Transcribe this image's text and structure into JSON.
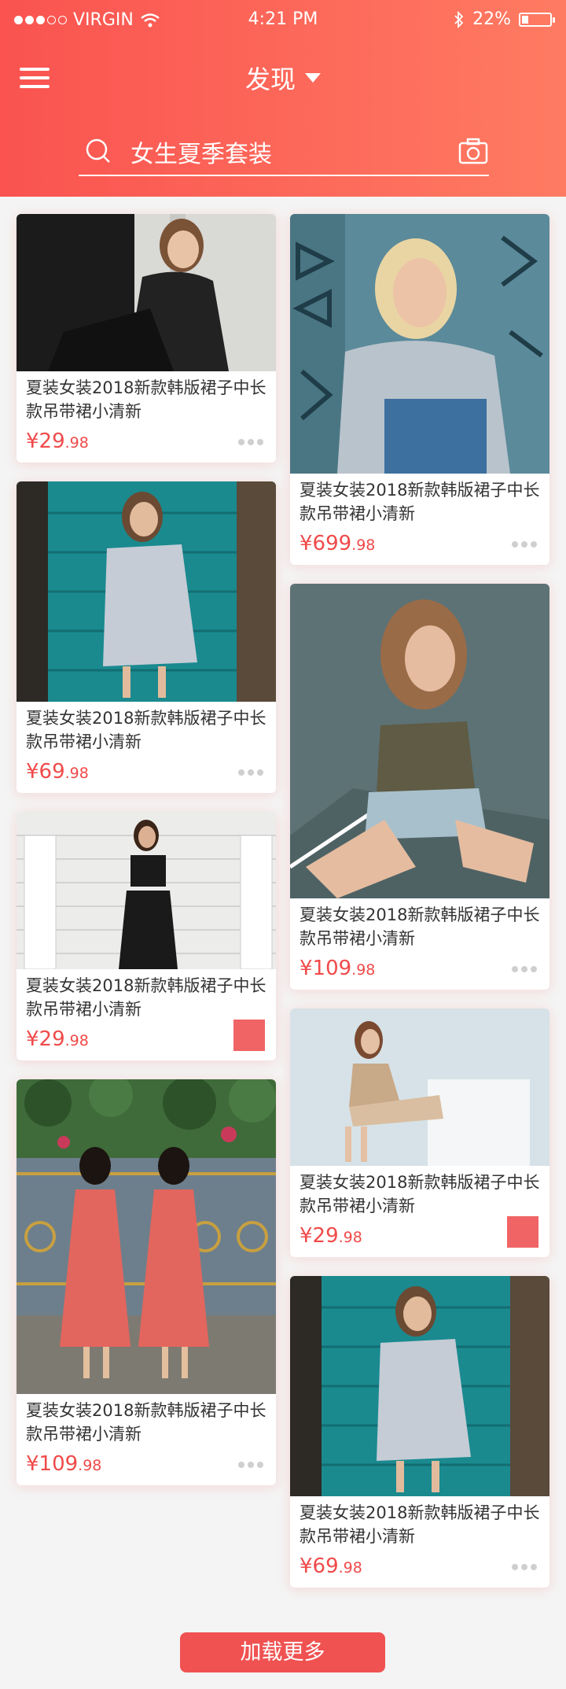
{
  "status_bar": {
    "carrier": "VIRGIN",
    "time": "4:21 PM",
    "battery": "22%",
    "battery_level": 0.22
  },
  "nav": {
    "title": "发现"
  },
  "search": {
    "query": "女生夏季套装"
  },
  "products": [
    {
      "title": "夏装女装2018新款韩版裙子中长款吊带裙小清新",
      "price_main": "¥29",
      "price_cents": ".98",
      "action": "more"
    },
    {
      "title": "夏装女装2018新款韩版裙子中长款吊带裙小清新",
      "price_main": "¥699",
      "price_cents": ".98",
      "action": "more"
    },
    {
      "title": "夏装女装2018新款韩版裙子中长款吊带裙小清新",
      "price_main": "¥69",
      "price_cents": ".98",
      "action": "more"
    },
    {
      "title": "夏装女装2018新款韩版裙子中长款吊带裙小清新",
      "price_main": "¥109",
      "price_cents": ".98",
      "action": "more"
    },
    {
      "title": "夏装女装2018新款韩版裙子中长款吊带裙小清新",
      "price_main": "¥29",
      "price_cents": ".98",
      "action": "square"
    },
    {
      "title": "夏装女装2018新款韩版裙子中长款吊带裙小清新",
      "price_main": "¥29",
      "price_cents": ".98",
      "action": "square"
    },
    {
      "title": "夏装女装2018新款韩版裙子中长款吊带裙小清新",
      "price_main": "¥109",
      "price_cents": ".98",
      "action": "more"
    },
    {
      "title": "夏装女装2018新款韩版裙子中长款吊带裙小清新",
      "price_main": "¥69",
      "price_cents": ".98",
      "action": "more"
    }
  ],
  "load_more": "加载更多",
  "colors": {
    "accent": "#f05252",
    "gradient_start": "#fa5350",
    "gradient_end": "#ff7b62"
  }
}
